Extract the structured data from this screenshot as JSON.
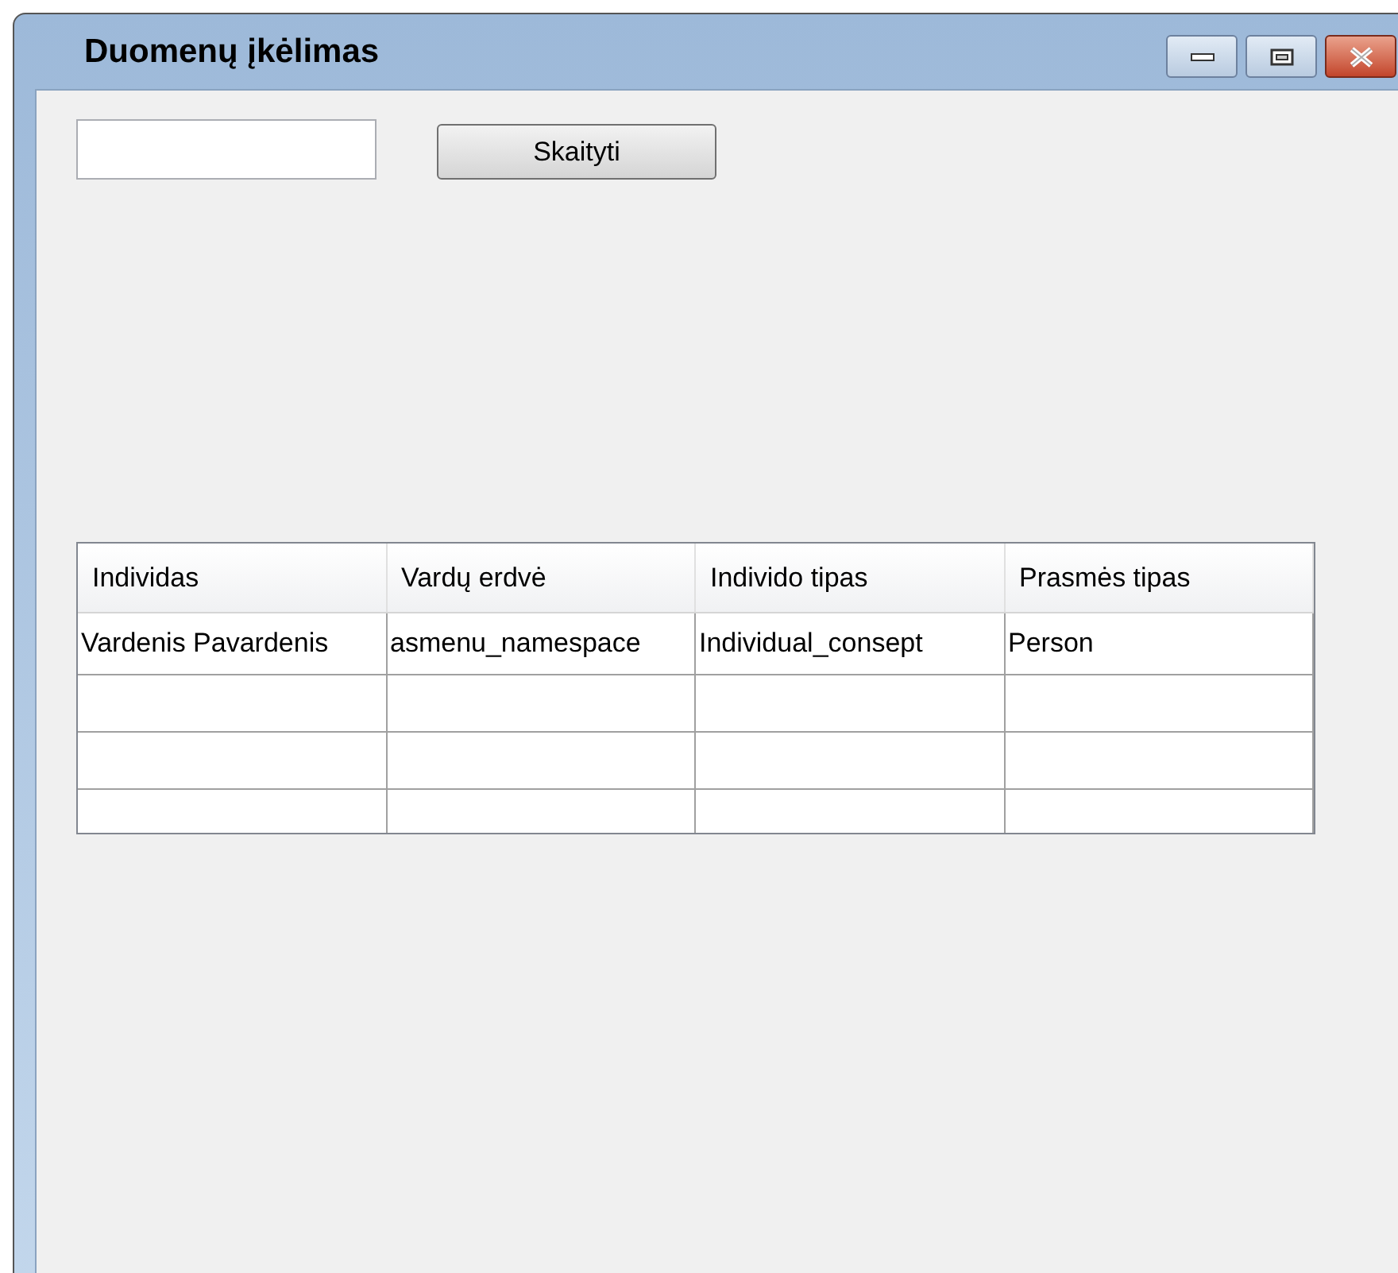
{
  "window": {
    "title": "Duomenų įkėlimas"
  },
  "form": {
    "button": "Skaityti"
  },
  "table": {
    "columns": [
      "Individas",
      "Vardų erdvė",
      "Individo tipas",
      "Prasmės tipas"
    ],
    "rows": [
      [
        "Vardenis Pavardenis",
        "asmenu_namespace",
        "Individual_consept",
        "Person"
      ]
    ]
  }
}
